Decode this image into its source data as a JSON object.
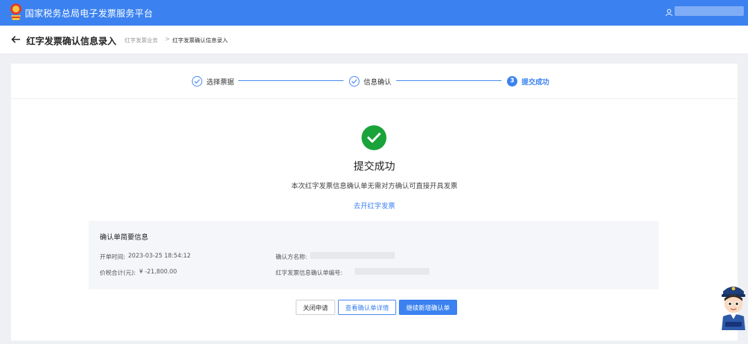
{
  "header": {
    "title": "国家税务总局电子发票服务平台",
    "emblem_icon": "tax-emblem-icon",
    "user_icon": "user-icon"
  },
  "page": {
    "title": "红字发票确认信息录入",
    "breadcrumb": [
      "红字发票业务",
      "红字发票确认信息录入"
    ],
    "breadcrumb_separator": ">"
  },
  "steps": [
    {
      "label": "选择票据",
      "state": "done"
    },
    {
      "label": "信息确认",
      "state": "done"
    },
    {
      "number": "3",
      "label": "提交成功",
      "state": "active"
    }
  ],
  "result": {
    "title": "提交成功",
    "description": "本次红字发票信息确认单无需对方确认可直接开具发票",
    "link": "去开红字发票"
  },
  "summary": {
    "title": "确认单简要信息",
    "issue_time_label": "开单时间:",
    "issue_time_value": "2023-03-25 18:54:12",
    "total_label": "价税合计(元):",
    "total_value": "¥ -21,800.00",
    "confirmer_label": "确认方名称:",
    "confirm_no_label": "红字发票信息确认单编号:"
  },
  "actions": {
    "close": "关闭申请",
    "view": "查看确认单详情",
    "continue": "继续新增确认单"
  },
  "colors": {
    "primary": "#3b82f0",
    "success": "#1aa33a"
  }
}
